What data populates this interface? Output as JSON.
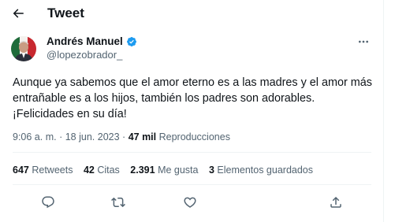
{
  "header": {
    "title": "Tweet"
  },
  "author": {
    "name": "Andrés Manuel",
    "handle": "@lopezobrador_",
    "verified": true
  },
  "tweet": {
    "text": "Aunque ya sabemos que el amor eterno es a las madres y el amor más entrañable es a los hijos, también los padres son adorables. ¡Felicidades en su día!",
    "time": "9:06 a. m.",
    "separator1": "·",
    "date": "18 jun. 2023",
    "separator2": "·",
    "views_count": "47 mil",
    "views_label": "Reproducciones"
  },
  "stats": {
    "retweets_count": "647",
    "retweets_label": "Retweets",
    "quotes_count": "42",
    "quotes_label": "Citas",
    "likes_count": "2.391",
    "likes_label": "Me gusta",
    "bookmarks_count": "3",
    "bookmarks_label": "Elementos guardados"
  },
  "icons": {
    "back": "arrow-left-icon",
    "more": "more-horizontal-icon",
    "verified": "verified-badge-icon",
    "reply": "reply-icon",
    "retweet": "retweet-icon",
    "like": "heart-icon",
    "share": "share-icon"
  },
  "colors": {
    "text_primary": "#0f1419",
    "text_secondary": "#536471",
    "verified_blue": "#1d9bf0",
    "divider": "#eff3f4"
  }
}
